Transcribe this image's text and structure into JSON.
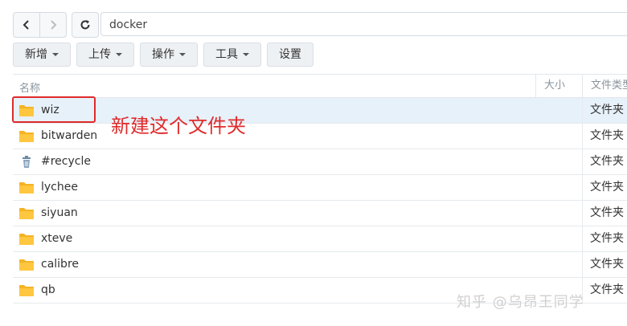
{
  "location": {
    "path": "docker"
  },
  "actions": [
    {
      "label": "新增",
      "dropdown": true
    },
    {
      "label": "上传",
      "dropdown": true
    },
    {
      "label": "操作",
      "dropdown": true
    },
    {
      "label": "工具",
      "dropdown": true
    },
    {
      "label": "设置",
      "dropdown": false
    }
  ],
  "columns": {
    "name": "名称",
    "size": "大小",
    "type": "文件类型"
  },
  "rows": [
    {
      "name": "wiz",
      "type": "文件夹",
      "icon": "folder-icon",
      "selected": true
    },
    {
      "name": "bitwarden",
      "type": "文件夹",
      "icon": "folder-icon"
    },
    {
      "name": "#recycle",
      "type": "文件夹",
      "icon": "recycle-bin-icon"
    },
    {
      "name": "lychee",
      "type": "文件夹",
      "icon": "folder-icon"
    },
    {
      "name": "siyuan",
      "type": "文件夹",
      "icon": "folder-icon"
    },
    {
      "name": "xteve",
      "type": "文件夹",
      "icon": "folder-icon"
    },
    {
      "name": "calibre",
      "type": "文件夹",
      "icon": "folder-icon"
    },
    {
      "name": "qb",
      "type": "文件夹",
      "icon": "folder-icon"
    }
  ],
  "annotation": {
    "text": "新建这个文件夹",
    "color": "#e02b2b"
  },
  "watermark": {
    "text": "知乎 @乌昂王同学"
  },
  "colors": {
    "folder": "#f5b324",
    "selected_row": "#e7f1fa",
    "highlight": "#e02b2b"
  }
}
